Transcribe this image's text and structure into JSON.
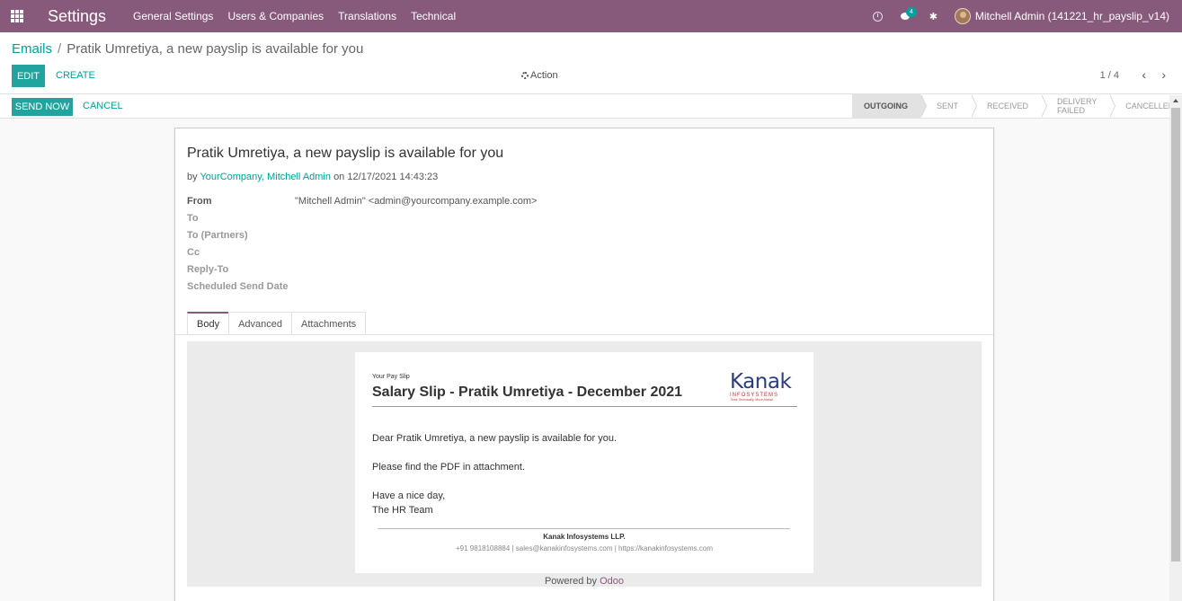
{
  "navbar": {
    "title": "Settings",
    "menu": [
      "General Settings",
      "Users & Companies",
      "Translations",
      "Technical"
    ],
    "chat_count": "4",
    "user_name": "Mitchell Admin (141221_hr_payslip_v14)"
  },
  "breadcrumb": {
    "parent": "Emails",
    "separator": "/",
    "current": "Pratik Umretiya, a new payslip is available for you"
  },
  "controls": {
    "edit": "EDIT",
    "create": "CREATE",
    "action": "Action",
    "pager": "1 / 4"
  },
  "statusbar": {
    "send_now": "SEND NOW",
    "cancel": "CANCEL",
    "stages": [
      "OUTGOING",
      "SENT",
      "RECEIVED",
      "DELIVERY FAILED",
      "CANCELLED"
    ],
    "active_stage": "OUTGOING"
  },
  "form": {
    "subject": "Pratik Umretiya, a new payslip is available for you",
    "by": "by",
    "author": "YourCompany, Mitchell Admin",
    "date": "on 12/17/2021 14:43:23",
    "fields": {
      "from_label": "From",
      "from_value": "\"Mitchell Admin\" <admin@yourcompany.example.com>",
      "to_label": "To",
      "to_partners_label": "To (Partners)",
      "cc_label": "Cc",
      "reply_to_label": "Reply-To",
      "scheduled_label": "Scheduled Send Date"
    },
    "tabs": [
      "Body",
      "Advanced",
      "Attachments"
    ]
  },
  "email": {
    "small_title": "Your Pay Slip",
    "title": "Salary Slip - Pratik Umretiya - December 2021",
    "logo_word": "Kanak",
    "logo_sub": "INFOSYSTEMS",
    "logo_tag": "Think Technically, Move Ahead",
    "greeting": "Dear Pratik Umretiya, a new payslip is available for you.",
    "body": "Please find the PDF in attachment.",
    "closing": "Have a nice day,",
    "signature": "The HR Team",
    "company": "Kanak Infosystems LLP.",
    "contact": "+91 9818108884 | sales@kanakinfosystems.com | https://kanakinfosystems.com",
    "powered_by": "Powered by",
    "powered_brand": "Odoo"
  }
}
